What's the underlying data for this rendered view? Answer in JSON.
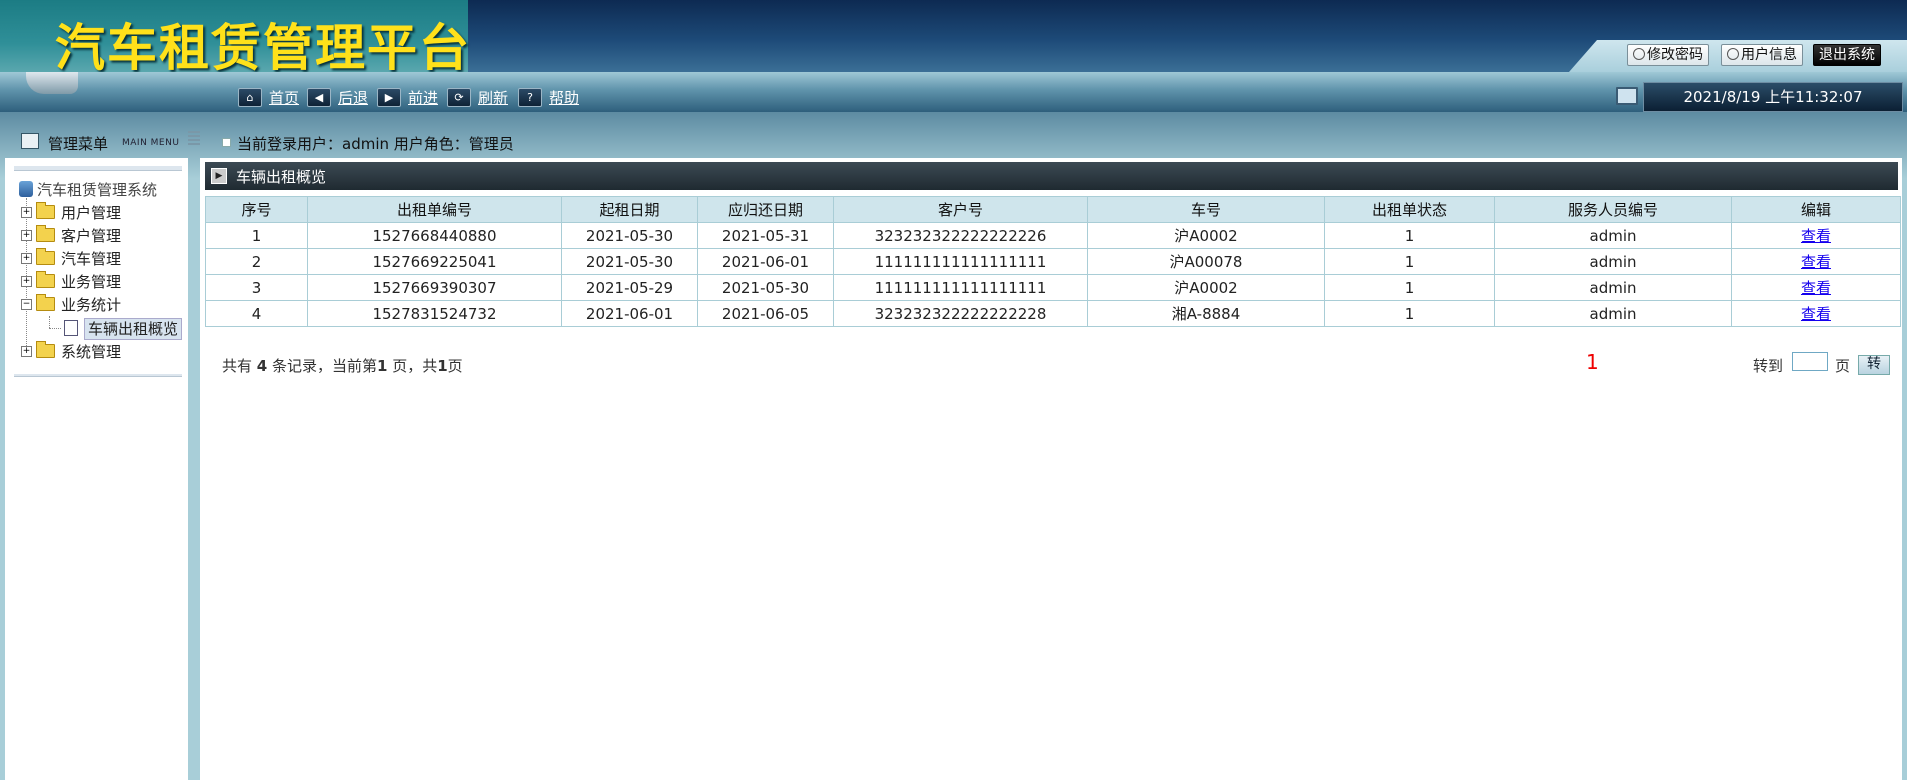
{
  "app": {
    "title": "汽车租赁管理平台"
  },
  "top_buttons": {
    "change_password": "修改密码",
    "user_info": "用户信息",
    "logout": "退出系统"
  },
  "nav": {
    "home": "首页",
    "back": "后退",
    "forward": "前进",
    "refresh": "刷新",
    "help": "帮助"
  },
  "clock": "2021/8/19 上午11:32:07",
  "menu": {
    "title": "管理菜单",
    "title_en": "MAIN MENU",
    "root": "汽车租赁管理系统",
    "items": [
      {
        "label": "用户管理",
        "expanded": false
      },
      {
        "label": "客户管理",
        "expanded": false
      },
      {
        "label": "汽车管理",
        "expanded": false
      },
      {
        "label": "业务管理",
        "expanded": false
      },
      {
        "label": "业务统计",
        "expanded": true,
        "children": [
          {
            "label": "车辆出租概览",
            "selected": true
          }
        ]
      },
      {
        "label": "系统管理",
        "expanded": false
      }
    ]
  },
  "user_bar": {
    "text": "当前登录用户：admin  用户角色：管理员"
  },
  "section": {
    "title": "车辆出租概览"
  },
  "table": {
    "headers": [
      "序号",
      "出租单编号",
      "起租日期",
      "应归还日期",
      "客户号",
      "车号",
      "出租单状态",
      "服务人员编号",
      "编辑"
    ],
    "rows": [
      [
        "1",
        "1527668440880",
        "2021-05-30",
        "2021-05-31",
        "323232322222222226",
        "沪A0002",
        "1",
        "admin",
        "查看"
      ],
      [
        "2",
        "1527669225041",
        "2021-05-30",
        "2021-06-01",
        "111111111111111111",
        "沪A00078",
        "1",
        "admin",
        "查看"
      ],
      [
        "3",
        "1527669390307",
        "2021-05-29",
        "2021-05-30",
        "111111111111111111",
        "沪A0002",
        "1",
        "admin",
        "查看"
      ],
      [
        "4",
        "1527831524732",
        "2021-06-01",
        "2021-06-05",
        "323232322222222228",
        "湘A-8884",
        "1",
        "admin",
        "查看"
      ]
    ]
  },
  "pager": {
    "total_prefix": "共有 ",
    "total": "4",
    "total_mid": " 条记录，当前第",
    "current": "1",
    "page_mid": " 页，共",
    "pages": "1",
    "page_suffix": "页",
    "page_number": "1",
    "goto_label": "转到",
    "goto_value": "",
    "page_label": "页",
    "goto_button": "转"
  },
  "colors": {
    "accent_red": "#ee0000",
    "link": "#1500ee",
    "logo_yellow": "#ffe11a",
    "table_header_bg": "#cfe5ec"
  }
}
